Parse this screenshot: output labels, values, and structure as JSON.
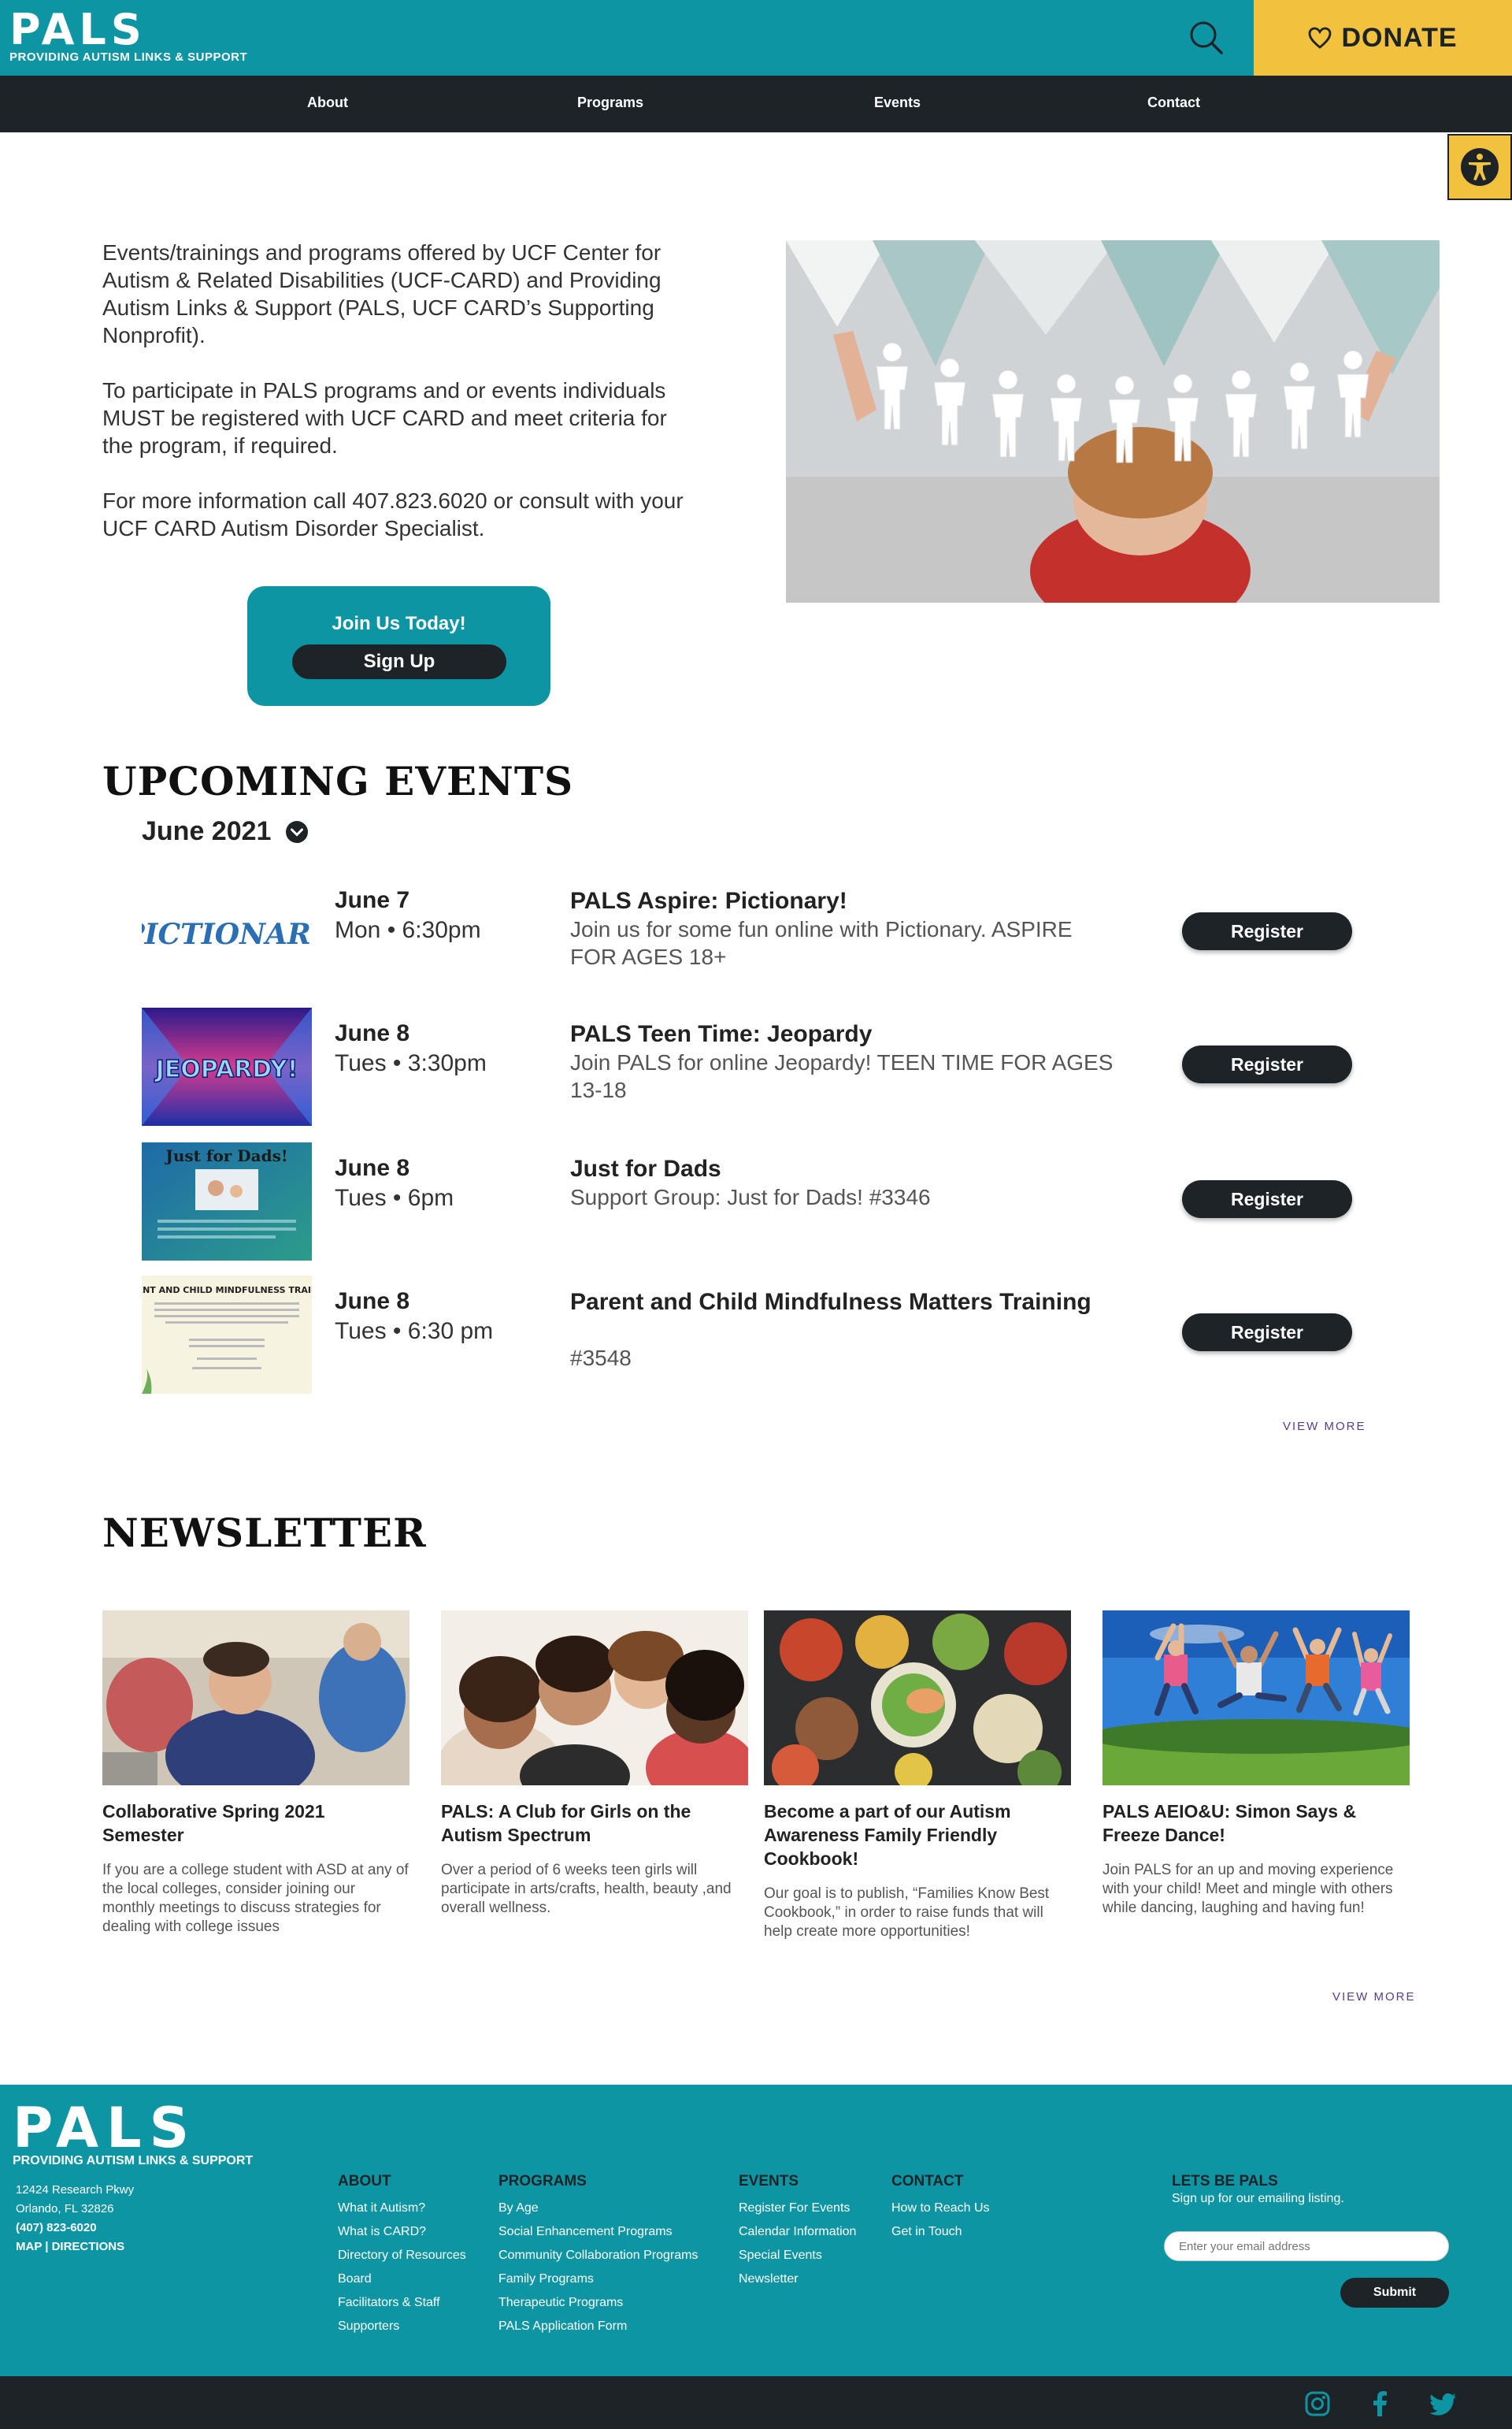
{
  "header": {
    "logo": "PALS",
    "tagline": "PROVIDING AUTISM LINKS & SUPPORT",
    "donate_label": "DONATE"
  },
  "nav": {
    "items": [
      "About",
      "Programs",
      "Events",
      "Contact"
    ]
  },
  "intro": {
    "paragraphs": [
      "Events/trainings and programs offered by UCF Center for Autism & Related Disabilities (UCF-CARD) and Providing Autism Links & Support (PALS, UCF CARD’s Supporting Nonprofit).",
      "To participate in PALS programs and or events individuals MUST be registered with UCF CARD and meet criteria for the program, if required.",
      "For more information call 407.823.6020 or consult with your UCF CARD Autism Disorder Specialist."
    ],
    "join_title": "Join Us Today!",
    "signup_label": "Sign Up"
  },
  "events": {
    "heading": "UPCOMING EVENTS",
    "month": "June 2021",
    "items": [
      {
        "thumb": "PICTIONARY",
        "date": "June 7",
        "time": "Mon • 6:30pm",
        "title": "PALS Aspire: Pictionary!",
        "desc": "Join us for some fun online with Pictionary. ASPIRE FOR AGES 18+",
        "button": "Register"
      },
      {
        "thumb": "JEOPARDY!",
        "date": "June 8",
        "time": "Tues • 3:30pm",
        "title": "PALS Teen Time: Jeopardy",
        "desc": "Join PALS for online Jeopardy! TEEN TIME FOR AGES 13-18",
        "button": "Register"
      },
      {
        "thumb": "Just for Dads!",
        "date": "June 8",
        "time": "Tues • 6pm",
        "title": "Just for Dads",
        "desc": "Support Group: Just for Dads! #3346",
        "button": "Register"
      },
      {
        "thumb": "PARENT AND CHILD MINDFULNESS TRAINING",
        "date": "June 8",
        "time": "Tues • 6:30 pm",
        "title": "Parent and Child Mindfulness Matters Training",
        "desc": "#3548",
        "button": "Register"
      }
    ],
    "view_more": "VIEW MORE"
  },
  "newsletter": {
    "heading": "NEWSLETTER",
    "items": [
      {
        "title": "Collaborative Spring 2021 Semester",
        "text": "If you are a college student with ASD at any of the local colleges, consider joining our monthly meetings to discuss strategies for dealing with college issues"
      },
      {
        "title": "PALS: A Club for Girls on the Autism Spectrum",
        "text": "Over a period of 6 weeks teen girls will participate in arts/crafts, health, beauty ,and overall wellness."
      },
      {
        "title": "Become a part of our Autism Awareness Family Friendly Cookbook!",
        "text": "Our goal is to publish, “Families Know Best Cookbook,” in order to raise funds that will help create more opportunities!"
      },
      {
        "title": "PALS AEIO&U: Simon Says & Freeze Dance!",
        "text": "Join PALS for an up and moving experience with your child! Meet and mingle with others while dancing, laughing and having fun!"
      }
    ],
    "view_more": "VIEW MORE"
  },
  "footer": {
    "logo": "PALS",
    "tagline": "PROVIDING AUTISM LINKS & SUPPORT",
    "address_line1": "12424 Research Pkwy",
    "address_line2": "Orlando, FL 32826",
    "phone": "(407) 823-6020",
    "map_link": "MAP | DIRECTIONS",
    "about": {
      "heading": "ABOUT",
      "links": [
        "What it Autism?",
        "What is CARD?",
        "Directory of Resources",
        "Board",
        "Facilitators & Staff",
        "Supporters"
      ]
    },
    "programs": {
      "heading": "PROGRAMS",
      "links": [
        "By Age",
        "Social Enhancement Programs",
        "Community Collaboration Programs",
        "Family Programs",
        "Therapeutic Programs",
        "PALS Application Form"
      ]
    },
    "events": {
      "heading": "EVENTS",
      "links": [
        "Register For Events",
        "Calendar Information",
        "Special Events",
        "Newsletter"
      ]
    },
    "contact": {
      "heading": "CONTACT",
      "links": [
        "How to Reach Us",
        "Get in Touch"
      ]
    },
    "signup": {
      "heading": "LETS BE PALS",
      "subtext": "Sign up for our emailing listing.",
      "placeholder": "Enter your email address",
      "submit": "Submit"
    }
  },
  "colors": {
    "teal": "#0d95a4",
    "dark": "#1d2326",
    "yellow": "#f2c23f"
  }
}
